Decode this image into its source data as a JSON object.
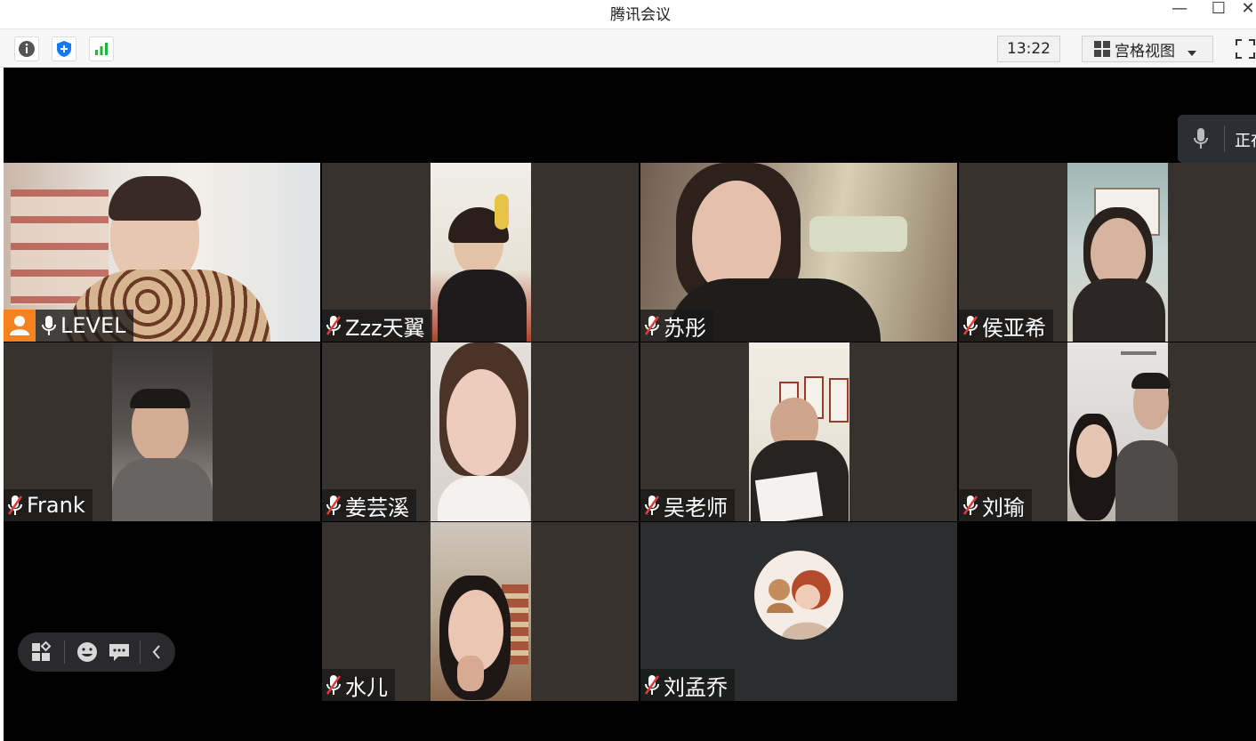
{
  "window": {
    "title": "腾讯会议",
    "minimize_glyph": "—",
    "maximize_glyph": "☐",
    "close_glyph": "✕"
  },
  "toolbar": {
    "icons": [
      "info-icon",
      "security-shield-icon",
      "network-signal-icon"
    ],
    "clock": "13:22",
    "view_mode": "宫格视图",
    "view_icon": "grid-view-icon",
    "fullscreen_icon": "fullscreen-icon"
  },
  "speaking_indicator": {
    "label": "正在",
    "icon": "microphone-icon"
  },
  "participants": [
    {
      "name": "LEVEL",
      "mic": "on",
      "host": true
    },
    {
      "name": "Zzz天翼",
      "mic": "muted"
    },
    {
      "name": "苏彤",
      "mic": "muted"
    },
    {
      "name": "侯亚希",
      "mic": "muted"
    },
    {
      "name": "Frank",
      "mic": "muted"
    },
    {
      "name": "姜芸溪",
      "mic": "muted"
    },
    {
      "name": "吴老师",
      "mic": "muted"
    },
    {
      "name": "刘瑜",
      "mic": "muted"
    },
    {
      "name": "水儿",
      "mic": "muted"
    },
    {
      "name": "刘孟乔",
      "mic": "muted",
      "video": "off",
      "avatar": "avatar-icon"
    }
  ],
  "floating_bar": {
    "icons": [
      "layout-icon",
      "emoji-reaction-icon",
      "chat-icon",
      "collapse-left-icon"
    ]
  },
  "colors": {
    "host_badge": "#f58220",
    "security_shield": "#1677ff",
    "signal_green": "#1bb934",
    "stage_bg": "#000000",
    "tile_bg": "#37322e",
    "muted_icon_red": "#e03b3b"
  }
}
